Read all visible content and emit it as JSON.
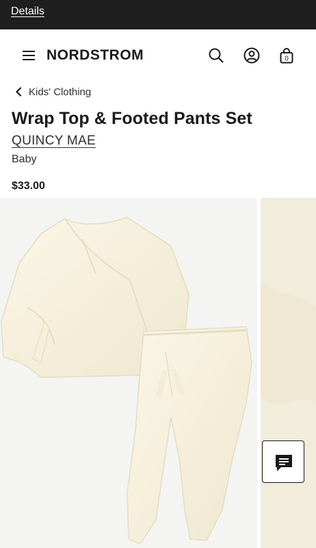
{
  "promo": {
    "details_link": "Details"
  },
  "header": {
    "logo": "NORDSTROM",
    "bag_count": "0"
  },
  "breadcrumb": {
    "label": "Kids' Clothing"
  },
  "product": {
    "title": "Wrap Top & Footed Pants Set",
    "brand": "QUINCY MAE",
    "category": "Baby",
    "price": "$33.00",
    "color_tone": "#f6f0dc"
  },
  "icons": {
    "menu": "hamburger-icon",
    "search": "search-icon",
    "account": "account-icon",
    "bag": "shopping-bag-icon",
    "back": "chevron-left-icon",
    "chat": "chat-icon"
  }
}
